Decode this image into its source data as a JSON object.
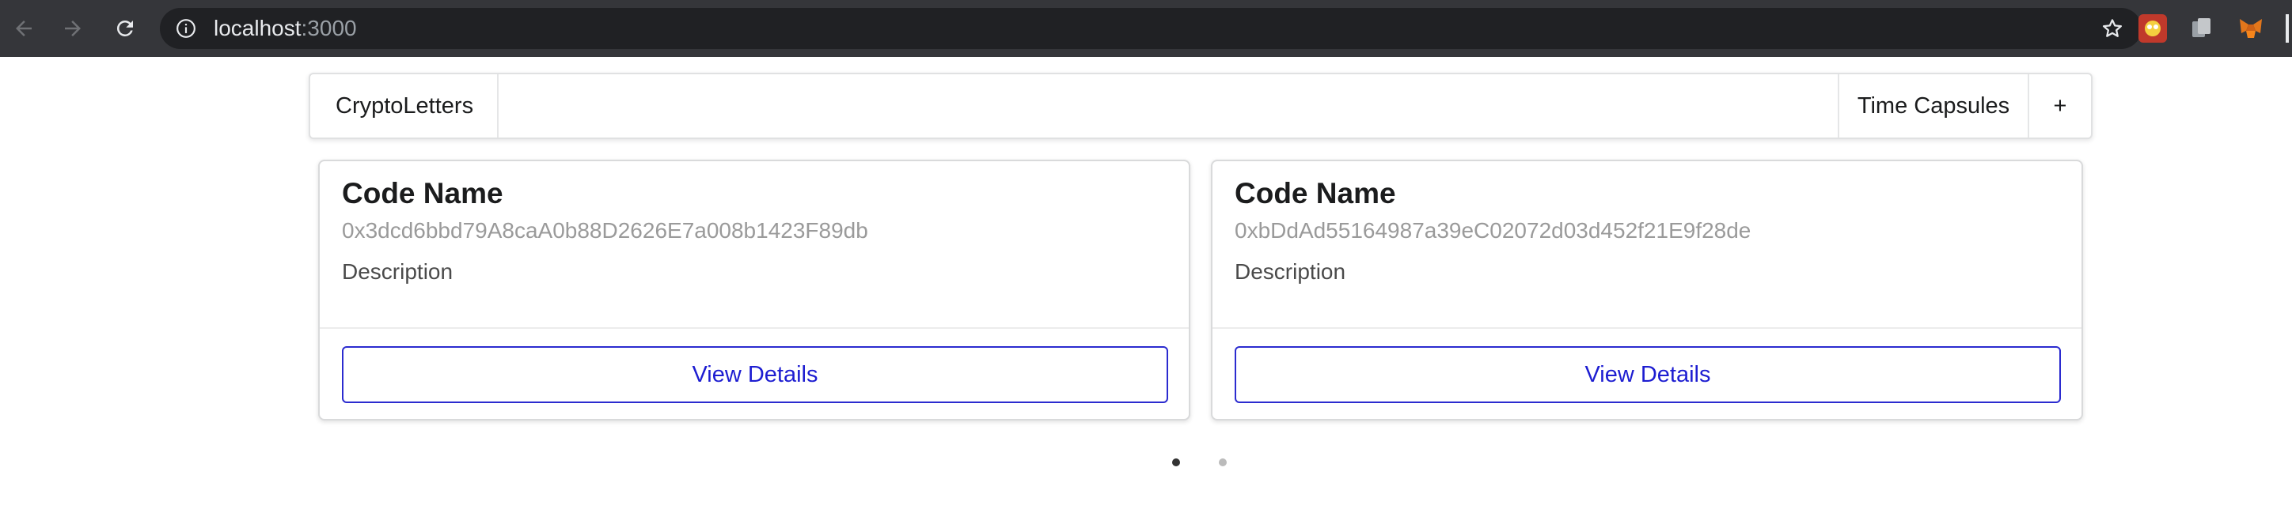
{
  "browser": {
    "url_host": "localhost",
    "url_port": ":3000"
  },
  "menu": {
    "brand": "CryptoLetters",
    "time_capsules": "Time Capsules",
    "add": "+"
  },
  "cards": [
    {
      "header": "Code Name",
      "address": "0x3dcd6bbd79A8caA0b88D2626E7a008b1423F89db",
      "description": "Description",
      "button": "View Details"
    },
    {
      "header": "Code Name",
      "address": "0xbDdAd55164987a39eC02072d03d452f21E9f28de",
      "description": "Description",
      "button": "View Details"
    }
  ],
  "carousel": {
    "active_index": 0,
    "total": 2
  },
  "colors": {
    "chrome_bg": "#35363a",
    "omnibox_bg": "#202124",
    "button_border": "#2b2bcf",
    "dot_active": "#333333",
    "dot_inactive": "#bbbbbb"
  }
}
